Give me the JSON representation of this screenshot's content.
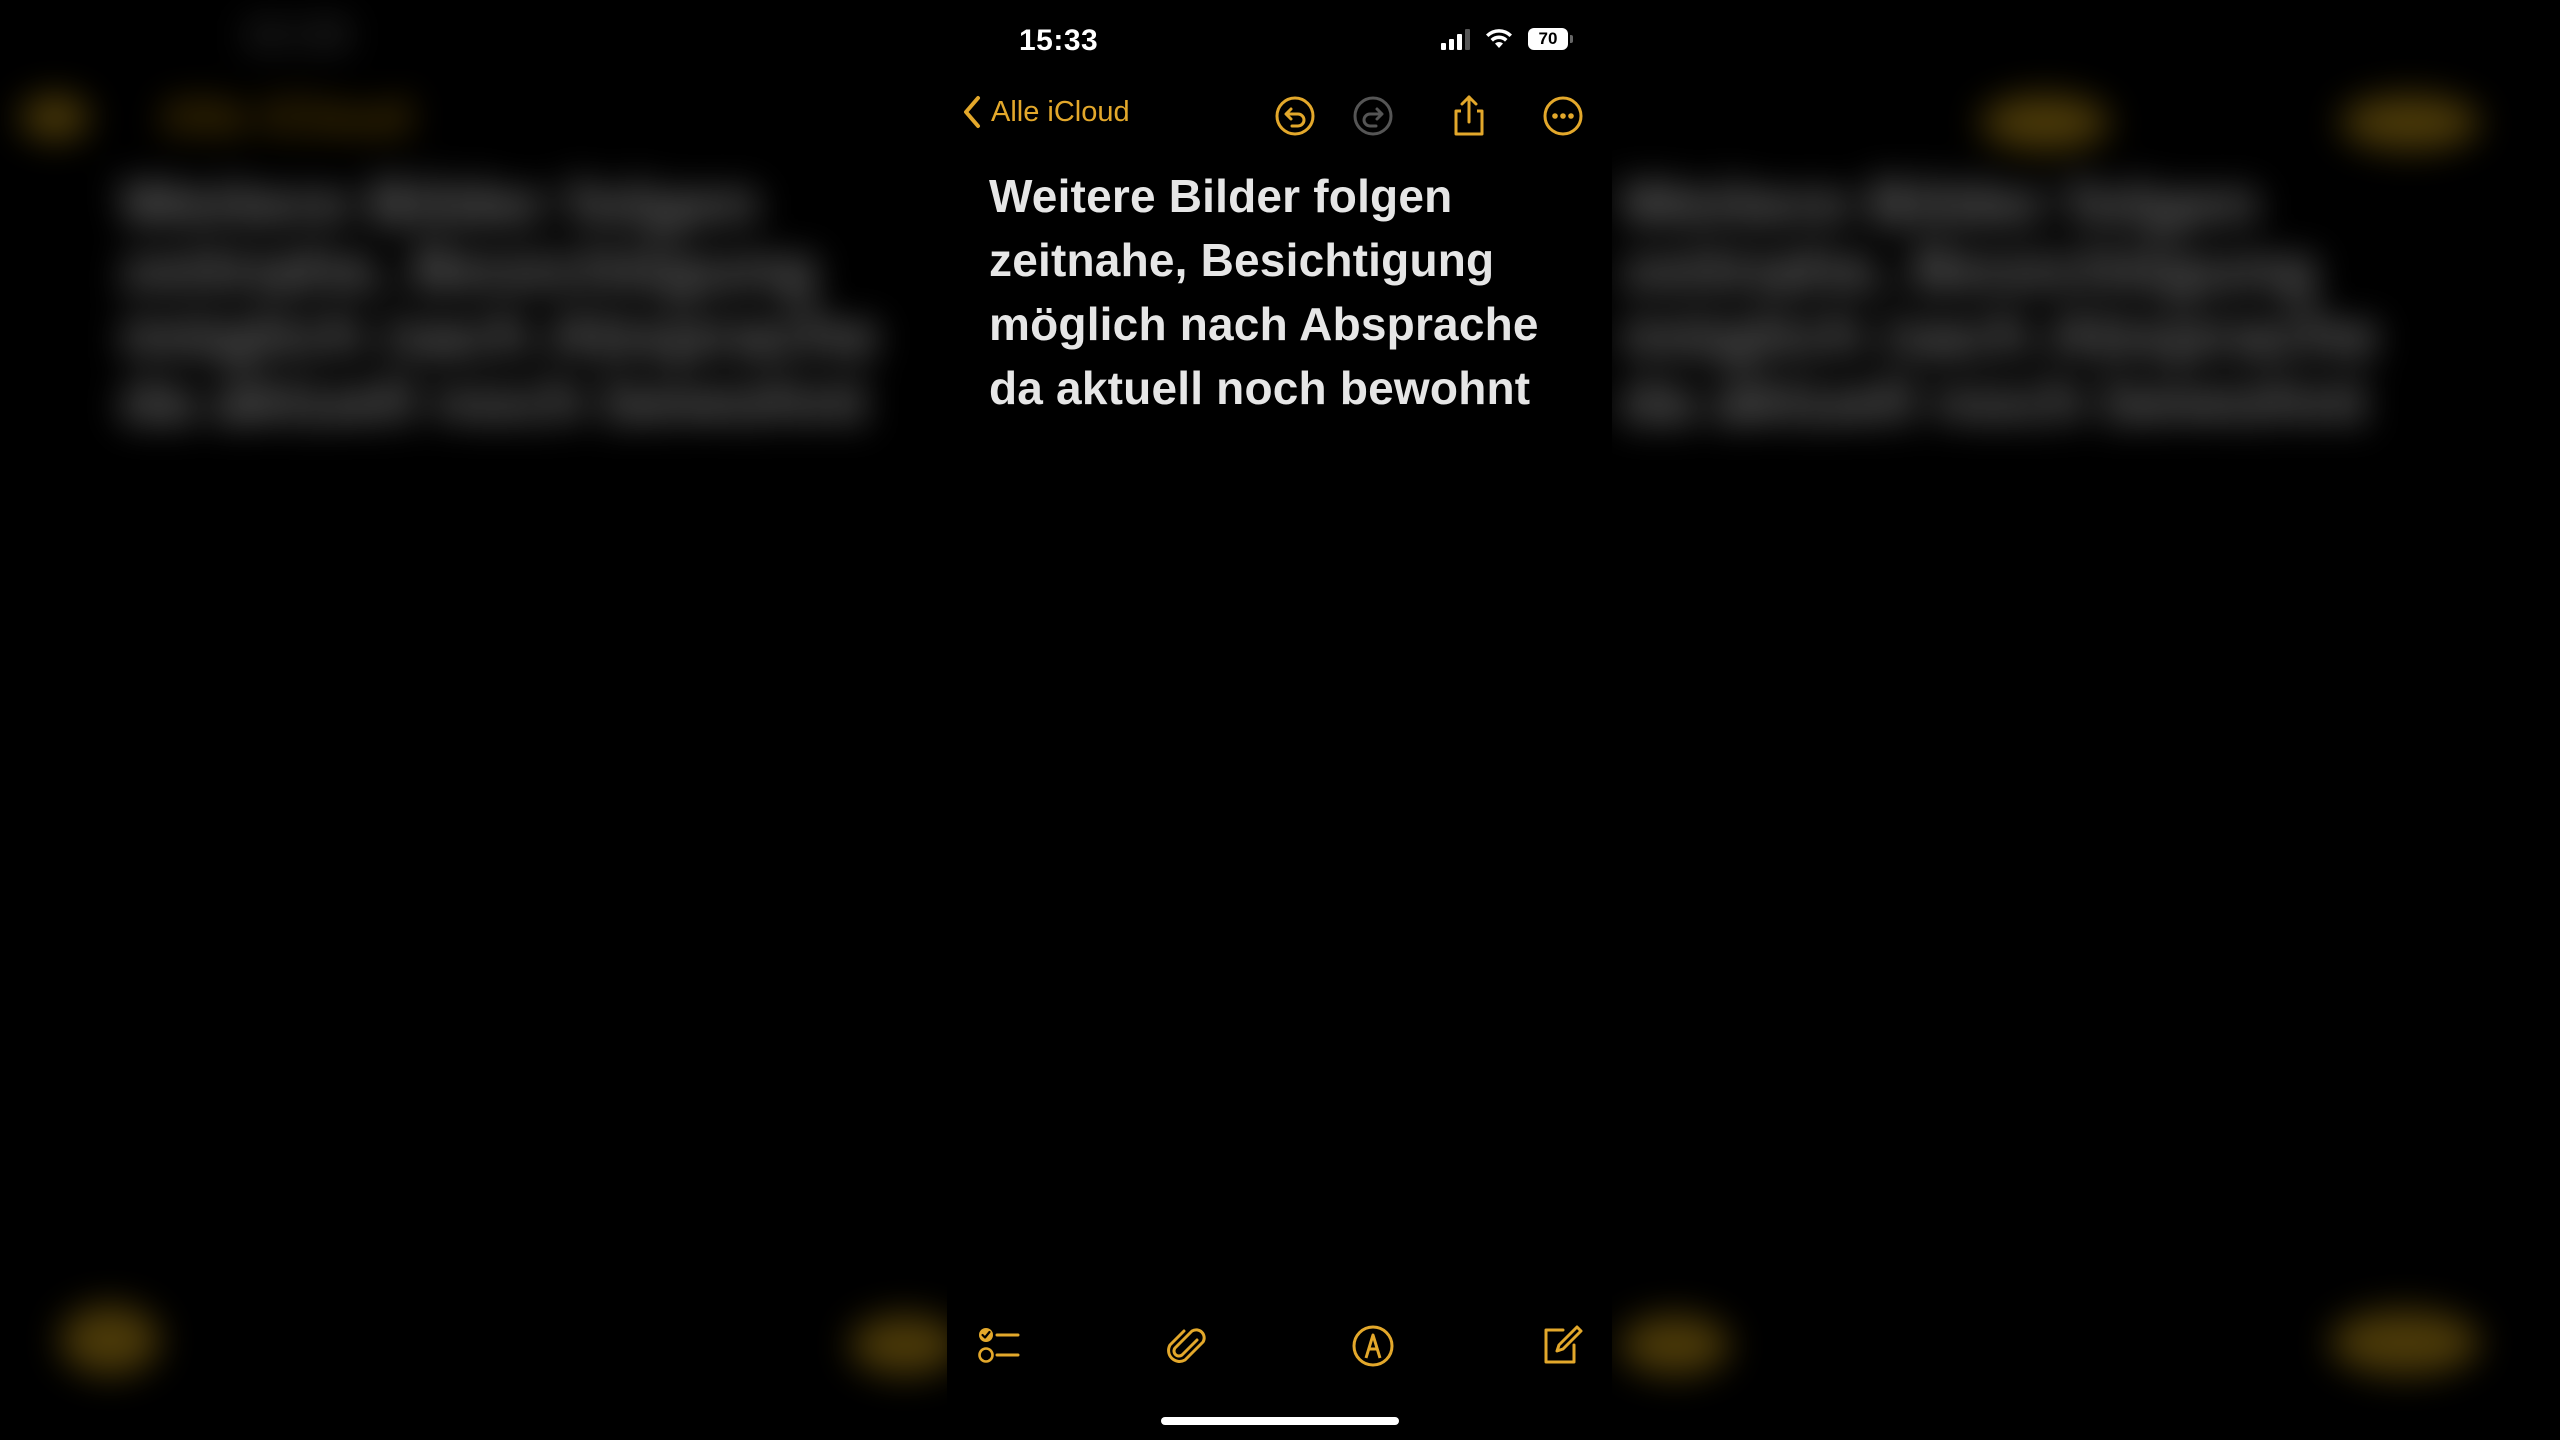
{
  "status_bar": {
    "time": "15:33",
    "battery": "70"
  },
  "nav": {
    "back_label": "Alle iCloud",
    "icons": [
      "chevron-left-icon",
      "undo-icon",
      "redo-icon",
      "share-icon",
      "more-icon"
    ]
  },
  "note": {
    "lines": [
      "Weitere Bilder folgen",
      "zeitnahe, Besichtigung",
      "möglich nach Absprache",
      "da aktuell noch bewohnt"
    ]
  },
  "toolbar": {
    "icons": [
      "checklist-icon",
      "paperclip-icon",
      "markup-icon",
      "compose-icon"
    ]
  },
  "colors": {
    "accent": "#e3a82b",
    "background": "#000000",
    "text": "#e6e6e6"
  }
}
